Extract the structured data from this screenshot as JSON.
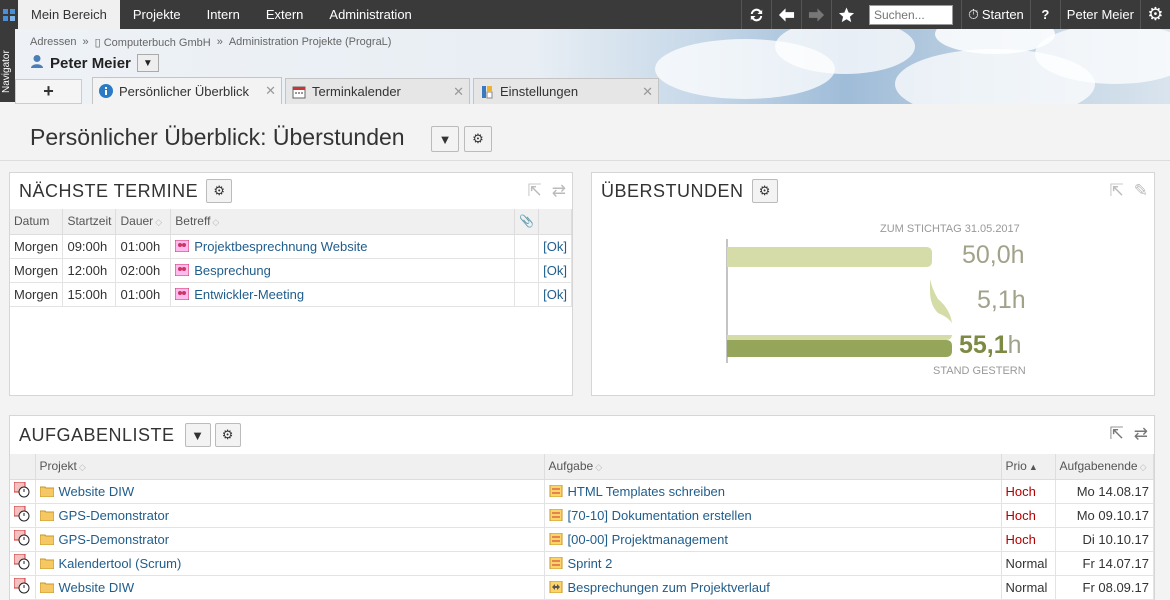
{
  "topbar": {
    "nav": [
      "Mein Bereich",
      "Projekte",
      "Intern",
      "Extern",
      "Administration"
    ],
    "search_placeholder": "Suchen...",
    "start_label": "Starten",
    "help_label": "?",
    "user_label": "Peter Meier"
  },
  "navigator_label": "Navigator",
  "breadcrumb": [
    "Adressen",
    "»",
    "Computerbuch GmbH",
    "»",
    "Administration Projekte (PrograL)"
  ],
  "user_name": "Peter Meier",
  "tabs": [
    {
      "label": "Persönlicher Überblick",
      "icon": "info-icon"
    },
    {
      "label": "Terminkalender",
      "icon": "calendar-icon"
    },
    {
      "label": "Einstellungen",
      "icon": "settings-icon"
    }
  ],
  "tab_add": "+",
  "page_title": "Persönlicher Überblick: Überstunden",
  "termine": {
    "title": "NÄCHSTE TERMINE",
    "columns": [
      "Datum",
      "Startzeit",
      "Dauer",
      "Betreff"
    ],
    "rows": [
      {
        "datum": "Morgen",
        "start": "09:00h",
        "dauer": "01:00h",
        "betreff": "Projektbesprechnung Website",
        "status": "[Ok]"
      },
      {
        "datum": "Morgen",
        "start": "12:00h",
        "dauer": "02:00h",
        "betreff": "Besprechung",
        "status": "[Ok]"
      },
      {
        "datum": "Morgen",
        "start": "15:00h",
        "dauer": "01:00h",
        "betreff": "Entwickler-Meeting",
        "status": "[Ok]"
      }
    ]
  },
  "ueberstunden": {
    "title": "ÜBERSTUNDEN",
    "stichtag": "ZUM STICHTAG 31.05.2017",
    "value1": "50,0",
    "value2": "5,1",
    "total": "55,1",
    "unit": "h",
    "stand": "STAND GESTERN",
    "colors": {
      "light": "#d5dca8",
      "dark": "#95a65a"
    }
  },
  "aufgaben": {
    "title": "AUFGABENLISTE",
    "columns": [
      "Projekt",
      "Aufgabe",
      "Prio",
      "Aufgabenende"
    ],
    "rows": [
      {
        "projekt": "Website DIW",
        "aufgabe": "HTML Templates schreiben",
        "prio": "Hoch",
        "ende": "Mo 14.08.17"
      },
      {
        "projekt": "GPS-Demonstrator",
        "aufgabe": "[70-10] Dokumentation erstellen",
        "prio": "Hoch",
        "ende": "Mo 09.10.17"
      },
      {
        "projekt": "GPS-Demonstrator",
        "aufgabe": "[00-00] Projektmanagement",
        "prio": "Hoch",
        "ende": "Di 10.10.17"
      },
      {
        "projekt": "Kalendertool (Scrum)",
        "aufgabe": "Sprint 2",
        "prio": "Normal",
        "ende": "Fr 14.07.17"
      },
      {
        "projekt": "Website DIW",
        "aufgabe": "Besprechungen zum Projektverlauf",
        "prio": "Normal",
        "ende": "Fr 08.09.17"
      }
    ]
  }
}
